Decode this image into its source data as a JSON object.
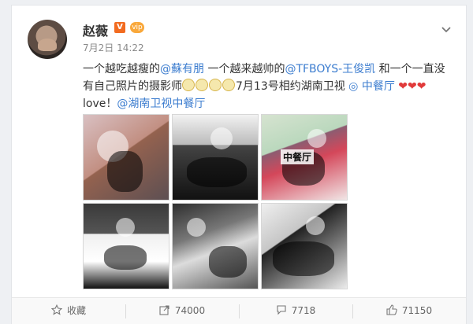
{
  "post": {
    "author": "赵薇",
    "verified_mark": "V",
    "membership_mark": "vip",
    "timestamp": "7月2日 14:22",
    "text": {
      "part1": "一个越吃越瘦的",
      "mention1": "@蘇有朋",
      "part2": " 一个越来越帅的",
      "mention2": "@TFBOYS-王俊凯",
      "part3": " 和一个一直没有自己照片的摄影师",
      "part4": "7月13号相约湖南卫视 ",
      "link1": "中餐厅",
      "part5": " love！",
      "mention3": "@湖南卫视中餐厅"
    },
    "photo_text": "中餐厅"
  },
  "actions": {
    "favorite_label": "收藏",
    "share_count": "74000",
    "comment_count": "7718",
    "like_count": "71150"
  },
  "colors": {
    "link": "#3b7ccf",
    "accent": "#f26b20"
  },
  "icons": [
    "chevron-down-icon",
    "star-icon",
    "share-icon",
    "comment-icon",
    "like-icon"
  ]
}
